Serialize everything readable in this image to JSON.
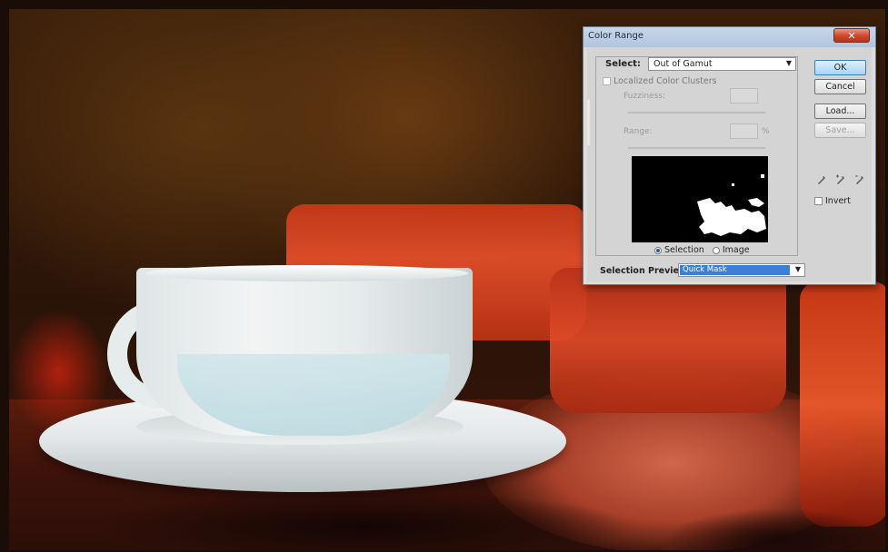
{
  "dialog": {
    "title": "Color Range",
    "close_glyph": "✕",
    "select_label": "Select:",
    "select_value": "Out of Gamut",
    "localized_label": "Localized Color Clusters",
    "fuzziness_label": "Fuzziness:",
    "range_label": "Range:",
    "range_unit": "%",
    "radio_selection": "Selection",
    "radio_image": "Image",
    "selection_preview_label": "Selection Preview:",
    "selection_preview_value": "Quick Mask",
    "buttons": {
      "ok": "OK",
      "cancel": "Cancel",
      "load": "Load...",
      "save": "Save..."
    },
    "eyedropper_icons": [
      "eyedropper-icon",
      "eyedropper-plus-icon",
      "eyedropper-minus-icon"
    ],
    "eyedropper_glyphs": "⁄⁄⁄",
    "invert_label": "Invert",
    "dropdown_glyph": "▼"
  },
  "colors": {
    "ok_button": "#a9d4f3",
    "preview_highlight": "#3b7fd8",
    "titlebar": "#b0c5df",
    "close_button": "#cf4b2e"
  }
}
